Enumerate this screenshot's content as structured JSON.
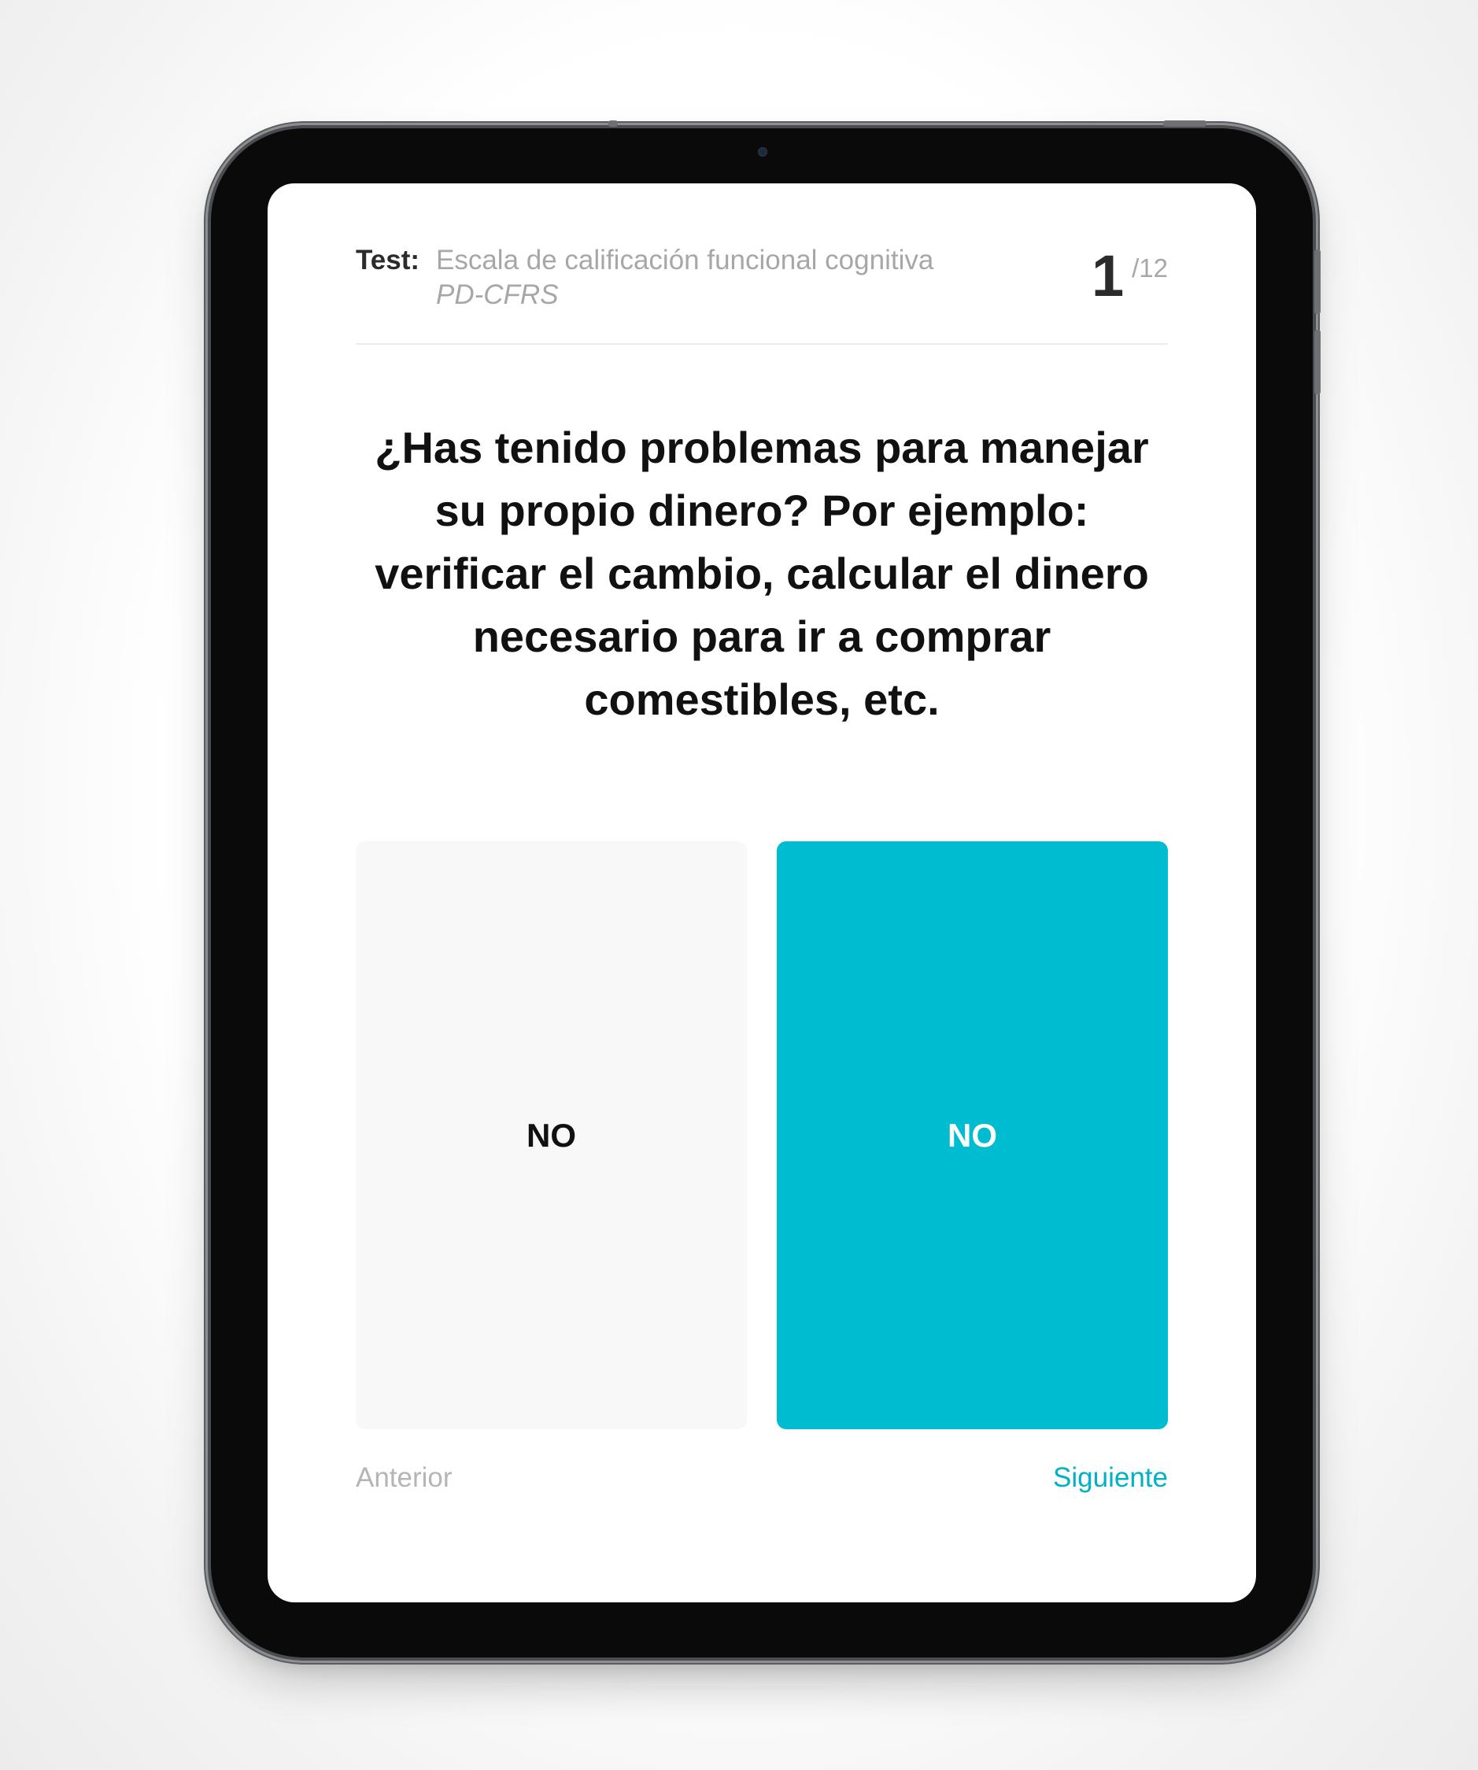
{
  "header": {
    "test_label": "Test:",
    "test_name": "Escala de calificación funcional cognitiva",
    "test_code": "PD-CFRS",
    "progress_current": "1",
    "progress_total": "/12"
  },
  "question": {
    "text": "¿Has tenido problemas para manejar su propio dinero? Por ejemplo: verificar el cambio, calcular el dinero necesario para ir a comprar comestibles, etc."
  },
  "options": [
    {
      "label": "NO",
      "selected": false
    },
    {
      "label": "NO",
      "selected": true
    }
  ],
  "navigation": {
    "prev_label": "Anterior",
    "next_label": "Siguiente"
  },
  "colors": {
    "accent": "#00bcd0",
    "option_unselected_bg": "#f8f8f8",
    "muted_text": "#a7a7a7",
    "device_frame": "#0a0a0a"
  }
}
